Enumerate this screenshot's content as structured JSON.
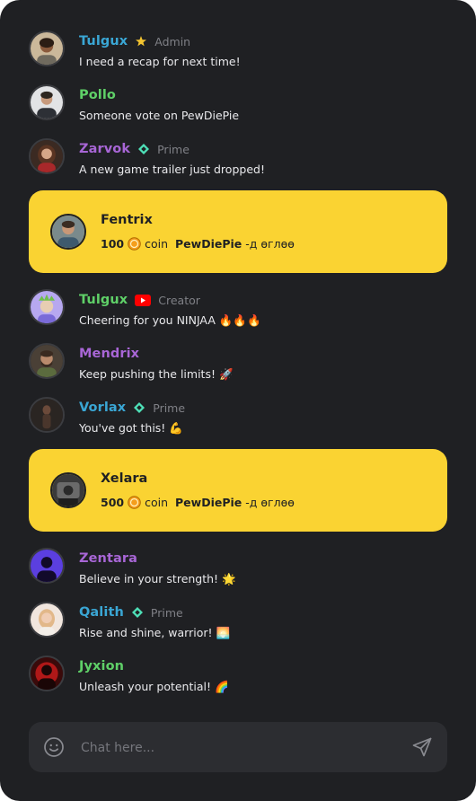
{
  "colors": {
    "panel_bg": "#1f2023",
    "donation_bg": "#fad332",
    "input_bg": "#2c2d31",
    "name_blue": "#3aa6d4",
    "name_green": "#5fd068",
    "name_purple": "#a866d6"
  },
  "messages": [
    {
      "name": "Tulgux",
      "name_color": "#3aa6d4",
      "badge": "star-icon",
      "role": "Admin",
      "text": "I need a recap for next time!"
    },
    {
      "name": "Pollo",
      "name_color": "#5fd068",
      "badge": "",
      "role": "",
      "text": "Someone vote on PewDiePie"
    },
    {
      "name": "Zarvok",
      "name_color": "#a866d6",
      "badge": "diamond-icon",
      "role": "Prime",
      "text": "A new game trailer just dropped!"
    },
    {
      "name": "Tulgux",
      "name_color": "#5fd068",
      "badge": "youtube-icon",
      "role": "Creator",
      "text": "Cheering for you NINJAA 🔥🔥🔥"
    },
    {
      "name": "Mendrix",
      "name_color": "#a866d6",
      "badge": "",
      "role": "",
      "text": "Keep pushing the limits! 🚀"
    },
    {
      "name": "Vorlax",
      "name_color": "#3aa6d4",
      "badge": "diamond-icon",
      "role": "Prime",
      "text": "You've got this! 💪"
    },
    {
      "name": "Zentara",
      "name_color": "#a866d6",
      "badge": "",
      "role": "",
      "text": "Believe in your strength! 🌟"
    },
    {
      "name": "Qalith",
      "name_color": "#3aa6d4",
      "badge": "diamond-icon",
      "role": "Prime",
      "text": "Rise and shine, warrior! 🌅"
    },
    {
      "name": "Jyxion",
      "name_color": "#5fd068",
      "badge": "",
      "role": "",
      "text": "Unleash your potential! 🌈"
    }
  ],
  "donations": [
    {
      "name": "Fentrix",
      "amount": "100",
      "coin_label": "coin",
      "channel": "PewDiePie",
      "suffix": "-д өглөө"
    },
    {
      "name": "Xelara",
      "amount": "500",
      "coin_label": "coin",
      "channel": "PewDiePie",
      "suffix": "-д өглөө"
    }
  ],
  "chat_input": {
    "placeholder": "Chat here...",
    "value": ""
  },
  "icons": {
    "emoji": "smiley-icon",
    "send": "send-icon",
    "coin": "coin-icon"
  }
}
